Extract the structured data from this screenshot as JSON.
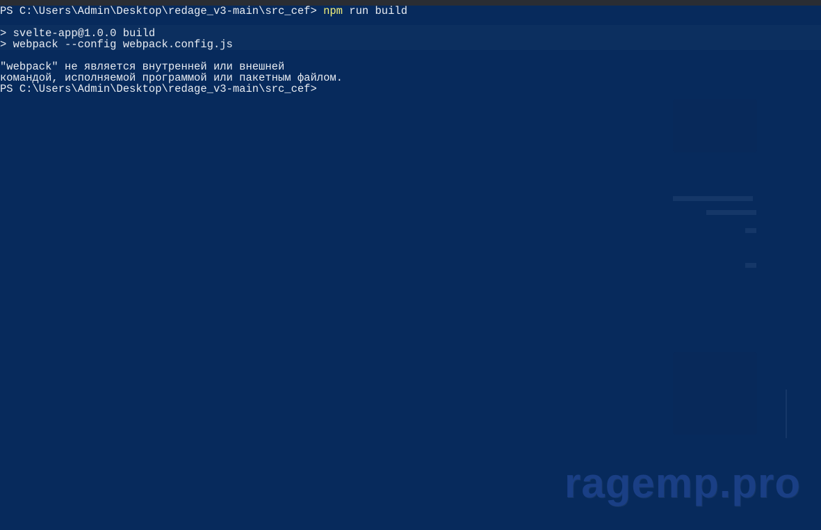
{
  "terminal": {
    "lines": [
      {
        "prompt": "PS C:\\Users\\Admin\\Desktop\\redage_v3-main\\src_cef> ",
        "command": "npm",
        "args": " run build"
      },
      {
        "text": ""
      },
      {
        "text": "> svelte-app@1.0.0 build"
      },
      {
        "text": "> webpack --config webpack.config.js"
      },
      {
        "text": ""
      },
      {
        "text": "\"webpack\" не является внутренней или внешней"
      },
      {
        "text": "командой, исполняемой программой или пакетным файлом."
      },
      {
        "text": "PS C:\\Users\\Admin\\Desktop\\redage_v3-main\\src_cef>"
      }
    ]
  },
  "watermark": {
    "text": "ragemp.pro"
  },
  "colors": {
    "background": "#072a5c",
    "text": "#e8ecf2",
    "command": "#f3f07a",
    "watermark": "#1a3f85"
  }
}
